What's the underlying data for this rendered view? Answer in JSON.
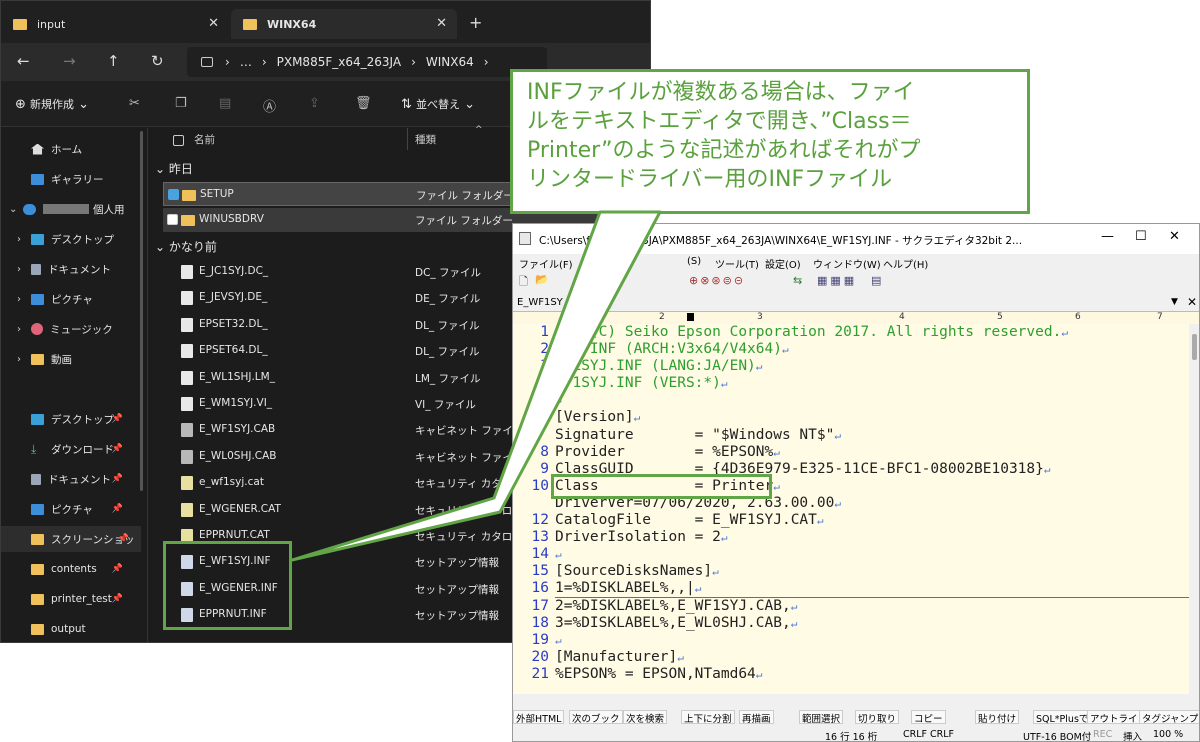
{
  "explorer": {
    "tabs": [
      {
        "label": "input"
      },
      {
        "label": "WINX64"
      }
    ],
    "address": {
      "ellipsis": "…",
      "crumb1": "PXM885F_x64_263JA",
      "crumb2": "WINX64"
    },
    "toolbar": {
      "new_label": "新規作成",
      "sort_label": "並べ替え"
    },
    "sidebar": [
      {
        "label": "ホーム"
      },
      {
        "label": "ギャラリー"
      },
      {
        "label": "個人用"
      },
      {
        "label": "デスクトップ"
      },
      {
        "label": "ドキュメント"
      },
      {
        "label": "ピクチャ"
      },
      {
        "label": "ミュージック"
      },
      {
        "label": "動画"
      },
      {
        "label": "デスクトップ"
      },
      {
        "label": "ダウンロード"
      },
      {
        "label": "ドキュメント"
      },
      {
        "label": "ピクチャ"
      },
      {
        "label": "スクリーンショッ"
      },
      {
        "label": "contents"
      },
      {
        "label": "printer_test"
      },
      {
        "label": "output"
      }
    ],
    "columns": {
      "name": "名前",
      "type": "種類"
    },
    "groups": {
      "yesterday": "昨日",
      "long_ago": "かなり前"
    },
    "files_yesterday": [
      {
        "name": "SETUP",
        "type": "ファイル フォルダー"
      },
      {
        "name": "WINUSBDRV",
        "type": "ファイル フォルダー"
      }
    ],
    "files_old": [
      {
        "name": "E_JC1SYJ.DC_",
        "type": "DC_ ファイル"
      },
      {
        "name": "E_JEVSYJ.DE_",
        "type": "DE_ ファイル"
      },
      {
        "name": "EPSET32.DL_",
        "type": "DL_ ファイル"
      },
      {
        "name": "EPSET64.DL_",
        "type": "DL_ ファイル"
      },
      {
        "name": "E_WL1SHJ.LM_",
        "type": "LM_ ファイル"
      },
      {
        "name": "E_WM1SYJ.VI_",
        "type": "VI_ ファイル"
      },
      {
        "name": "E_WF1SYJ.CAB",
        "type": "キャビネット ファイル"
      },
      {
        "name": "E_WL0SHJ.CAB",
        "type": "キャビネット ファイル"
      },
      {
        "name": "e_wf1syj.cat",
        "type": "セキュリティ カタログ"
      },
      {
        "name": "E_WGENER.CAT",
        "type": "セキュリティ カタログ"
      },
      {
        "name": "EPPRNUT.CAT",
        "type": "セキュリティ カタログ"
      },
      {
        "name": "E_WF1SYJ.INF",
        "type": "セットアップ情報"
      },
      {
        "name": "E_WGENER.INF",
        "type": "セットアップ情報"
      },
      {
        "name": "EPPRNUT.INF",
        "type": "セットアップ情報"
      }
    ]
  },
  "callout": {
    "line1": "INFファイルが複数ある場合は、ファイ",
    "line2": "ルをテキストエディタで開き、”Class＝",
    "line3": "Printer”のような記述があればそれがプ",
    "line4": "リンタードライバー用のINFファイル"
  },
  "editor": {
    "title": "C:\\Users\\f… x64_263JA\\PXM885F_x64_263JA\\WINX64\\E_WF1SYJ.INF - サクラエディタ32bit 2...",
    "menu": [
      "ファイル(F)",
      "(S)",
      "ツール(T)",
      "設定(O)",
      "ウィンドウ(W)",
      "ヘルプ(H)"
    ],
    "tab": "E_WF1SY",
    "ruler": [
      "1",
      "2",
      "3",
      "4",
      "5",
      "6",
      "7"
    ],
    "lines": [
      {
        "n": "1",
        "t": "ght (C) Seiko Epson Corporation 2017. All rights reserved.",
        "c": "cm"
      },
      {
        "n": "2",
        "t": "SYJ.INF (ARCH:V3x64/V4x64)",
        "c": "cm"
      },
      {
        "n": "3",
        "t": "WF1SYJ.INF (LANG:JA/EN)",
        "c": "cm"
      },
      {
        "n": "",
        "t": "WF1SYJ.INF (VERS:*)",
        "c": "cm"
      },
      {
        "n": "",
        "t": "",
        "c": ""
      },
      {
        "n": "",
        "t": "[Version]",
        "c": ""
      },
      {
        "n": "",
        "t": "Signature       = \"$Windows NT$\"",
        "c": ""
      },
      {
        "n": "8",
        "t": "Provider        = %EPSON%",
        "c": ""
      },
      {
        "n": "9",
        "t": "ClassGUID       = {4D36E979-E325-11CE-BFC1-08002BE10318}",
        "c": ""
      },
      {
        "n": "10",
        "t": "Class           = Printer",
        "c": ""
      },
      {
        "n": "",
        "t": "DriverVer=07/06/2020, 2.63.00.00",
        "c": ""
      },
      {
        "n": "12",
        "t": "CatalogFile     = E_WF1SYJ.CAT",
        "c": ""
      },
      {
        "n": "13",
        "t": "DriverIsolation = 2",
        "c": ""
      },
      {
        "n": "14",
        "t": "",
        "c": ""
      },
      {
        "n": "15",
        "t": "[SourceDisksNames]",
        "c": ""
      },
      {
        "n": "16",
        "t": "1=%DISKLABEL%,,|",
        "c": ""
      },
      {
        "n": "17",
        "t": "2=%DISKLABEL%,E_WF1SYJ.CAB,",
        "c": ""
      },
      {
        "n": "18",
        "t": "3=%DISKLABEL%,E_WL0SHJ.CAB,",
        "c": ""
      },
      {
        "n": "19",
        "t": "",
        "c": ""
      },
      {
        "n": "20",
        "t": "[Manufacturer]",
        "c": ""
      },
      {
        "n": "21",
        "t": "%EPSON% = EPSON,NTamd64",
        "c": ""
      }
    ],
    "functions": [
      "外部HTML",
      "次のブック",
      "次を検索",
      "上下に分割",
      "再描画",
      "範囲選択",
      "切り取り",
      "コピー",
      "貼り付け",
      "SQL*Plusで",
      "アウトライン",
      "タグジャンプ"
    ],
    "status": {
      "pos": "16 行  16 桁",
      "eol": "CRLF CRLF",
      "enc": "UTF-16 BOM付",
      "mode": "REC",
      "ins": "挿入",
      "zoom": "100 %"
    }
  }
}
